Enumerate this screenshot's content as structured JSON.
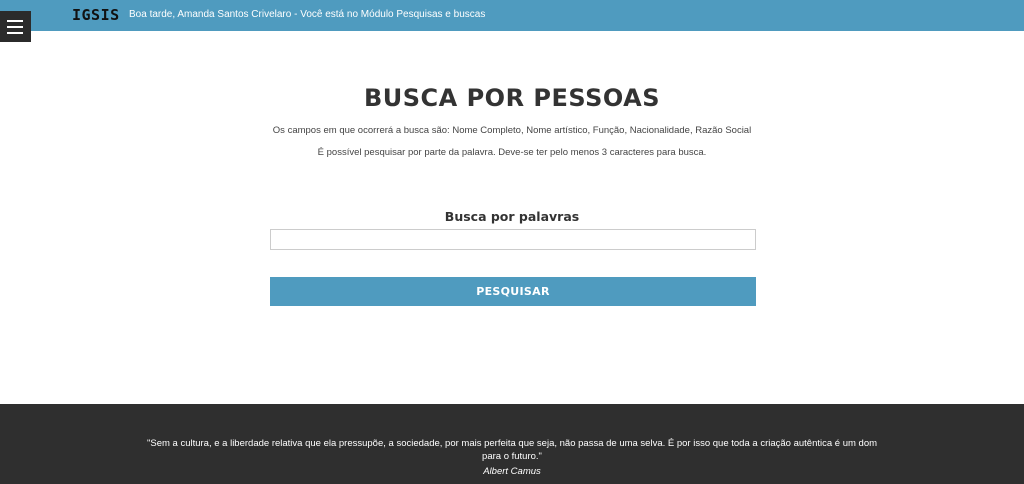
{
  "header": {
    "logo": "IGSIS",
    "greeting": "Boa tarde, Amanda Santos Crivelaro - Você está no Módulo Pesquisas e buscas",
    "menu_icon": "hamburger-menu-icon"
  },
  "main": {
    "title": "BUSCA POR PESSOAS",
    "description_line1": "Os campos em que ocorrerá a busca são: Nome Completo, Nome artístico, Função, Nacionalidade, Razão Social",
    "description_line2": "É possível pesquisar por parte da palavra. Deve-se ter pelo menos 3 caracteres para busca.",
    "search_label": "Busca por palavras",
    "search_value": "",
    "search_button": "PESQUISAR"
  },
  "footer": {
    "quote": "\"Sem a cultura, e a liberdade relativa que ela pressupõe, a sociedade, por mais perfeita que seja, não passa de uma selva. É por isso que toda a criação autêntica é um dom para o futuro.\"",
    "author": "Albert Camus"
  },
  "colors": {
    "header_bg": "#4f9bbf",
    "button_bg": "#4f9bbf",
    "footer_bg": "#2f2f2f",
    "menu_bg": "#2b2b2b"
  }
}
